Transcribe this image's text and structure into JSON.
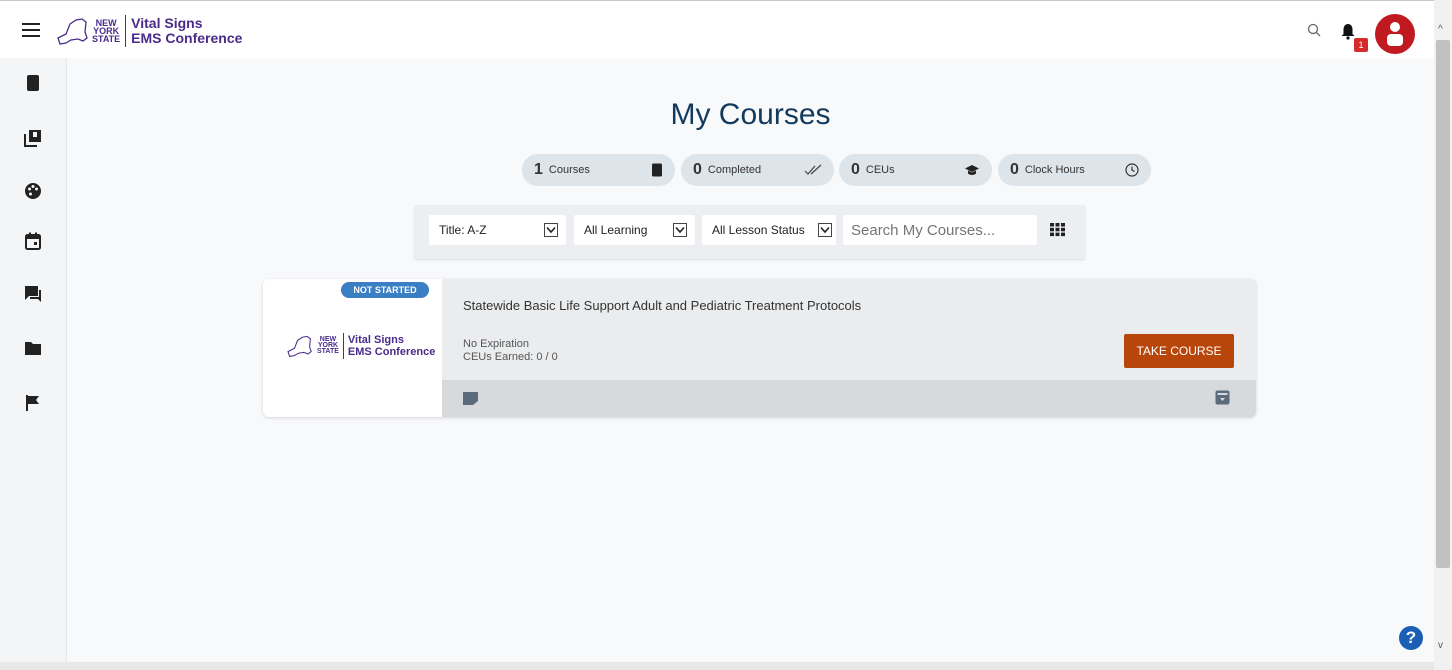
{
  "header": {
    "logo": {
      "nys": "NEW YORK STATE",
      "nys_lines": [
        "NEW",
        "YORK",
        "STATE"
      ],
      "name_lines": [
        "Vital Signs",
        "EMS Conference"
      ],
      "color": "#4a2b8a"
    },
    "notification_count": "1",
    "avatar_color": "#c0191f"
  },
  "sidebar": {
    "items": [
      {
        "name": "book-icon"
      },
      {
        "name": "library-icon"
      },
      {
        "name": "palette-icon"
      },
      {
        "name": "calendar-icon"
      },
      {
        "name": "forum-icon"
      },
      {
        "name": "folder-icon"
      },
      {
        "name": "flag-icon"
      }
    ]
  },
  "main": {
    "title": "My Courses",
    "stats": [
      {
        "value": "1",
        "label": "Courses",
        "icon": "book-icon"
      },
      {
        "value": "0",
        "label": "Completed",
        "icon": "double-check-icon"
      },
      {
        "value": "0",
        "label": "CEUs",
        "icon": "graduation-cap-icon"
      },
      {
        "value": "0",
        "label": "Clock Hours",
        "icon": "clock-icon"
      }
    ],
    "filters": {
      "sort": "Title: A-Z",
      "learning": "All Learning",
      "lesson_status": "All Lesson Status",
      "search_placeholder": "Search My Courses..."
    },
    "course": {
      "status": "NOT STARTED",
      "title": "Statewide Basic Life Support Adult and Pediatric Treatment Protocols",
      "expiration": "No Expiration",
      "ceus": "CEUs Earned: 0 / 0",
      "button": "TAKE COURSE",
      "status_color": "#3a7ec3",
      "button_color": "#b8460a"
    }
  },
  "help_label": "?"
}
